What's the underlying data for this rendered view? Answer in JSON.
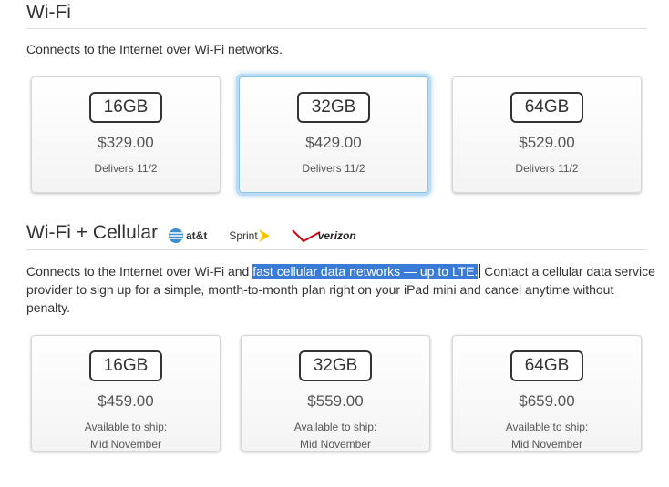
{
  "wifi": {
    "title": "Wi-Fi",
    "description": "Connects to the Internet over Wi-Fi networks.",
    "options": [
      {
        "capacity": "16GB",
        "price": "$329.00",
        "delivery": "Delivers 11/2"
      },
      {
        "capacity": "32GB",
        "price": "$429.00",
        "delivery": "Delivers 11/2"
      },
      {
        "capacity": "64GB",
        "price": "$529.00",
        "delivery": "Delivers 11/2"
      }
    ]
  },
  "cellular": {
    "title": "Wi-Fi + Cellular",
    "carriers": [
      "at&t",
      "Sprint",
      "verizon"
    ],
    "description_before": "Connects to the Internet over Wi-Fi and ",
    "description_highlight": "fast cellular data networks — up to LTE.",
    "description_after": " Contact a cellular data service provider to sign up for a simple, month-to-month plan right on your iPad mini and cancel anytime without penalty.",
    "options": [
      {
        "capacity": "16GB",
        "price": "$459.00",
        "ship_label": "Available to ship:",
        "ship_value": "Mid November"
      },
      {
        "capacity": "32GB",
        "price": "$559.00",
        "ship_label": "Available to ship:",
        "ship_value": "Mid November"
      },
      {
        "capacity": "64GB",
        "price": "$659.00",
        "ship_label": "Available to ship:",
        "ship_value": "Mid November"
      }
    ]
  },
  "colors": {
    "selection": "#3a7bd5",
    "selected_card_glow": "#8cc3e8",
    "verizon_red": "#cd040b",
    "sprint_yellow": "#f5c400",
    "att_blue": "#3a8fd0"
  }
}
